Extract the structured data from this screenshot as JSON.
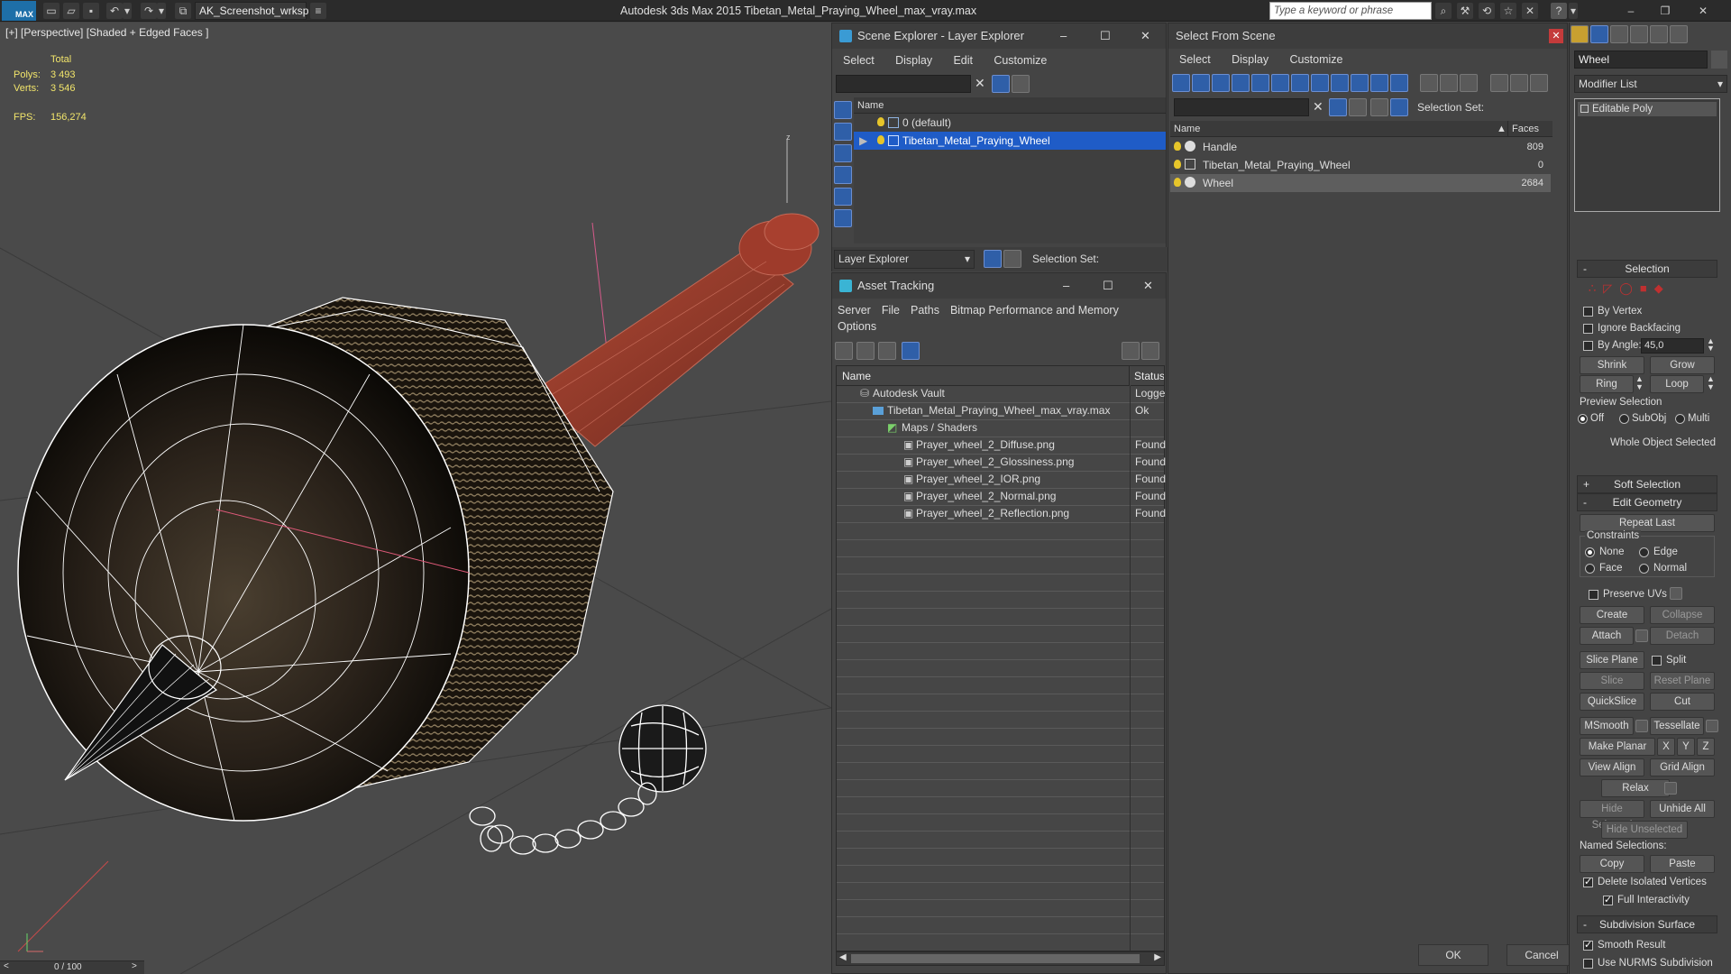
{
  "app": {
    "title": "Autodesk 3ds Max  2015    Tibetan_Metal_Praying_Wheel_max_vray.max",
    "workspace": "AK_Screenshot_wrksp",
    "search_placeholder": "Type a keyword or phrase",
    "logo": "MAX"
  },
  "viewport": {
    "label": "[+] [Perspective] [Shaded + Edged Faces ]",
    "stats_total": "Total",
    "polys_label": "Polys:",
    "polys_value": "3 493",
    "verts_label": "Verts:",
    "verts_value": "3 546",
    "fps_label": "FPS:",
    "fps_value": "156,274",
    "timeline": "0 / 100",
    "axis_label": "z"
  },
  "layer_explorer": {
    "title": "Scene Explorer - Layer Explorer",
    "menu": [
      "Select",
      "Display",
      "Edit",
      "Customize"
    ],
    "col_name": "Name",
    "rows": [
      "0 (default)",
      "Tibetan_Metal_Praying_Wheel"
    ],
    "footer_label": "Layer Explorer",
    "selection_set": "Selection Set:"
  },
  "asset_tracking": {
    "title": "Asset Tracking",
    "menu": [
      "Server",
      "File",
      "Paths",
      "Bitmap Performance and Memory",
      "Options"
    ],
    "col_name": "Name",
    "col_status": "Status",
    "rows": [
      {
        "name": "Autodesk Vault",
        "status": "Logge"
      },
      {
        "name": "Tibetan_Metal_Praying_Wheel_max_vray.max",
        "status": "Ok"
      },
      {
        "name": "Maps / Shaders",
        "status": ""
      },
      {
        "name": "Prayer_wheel_2_Diffuse.png",
        "status": "Found"
      },
      {
        "name": "Prayer_wheel_2_Glossiness.png",
        "status": "Found"
      },
      {
        "name": "Prayer_wheel_2_IOR.png",
        "status": "Found"
      },
      {
        "name": "Prayer_wheel_2_Normal.png",
        "status": "Found"
      },
      {
        "name": "Prayer_wheel_2_Reflection.png",
        "status": "Found"
      }
    ]
  },
  "select_from_scene": {
    "title": "Select From Scene",
    "menu": [
      "Select",
      "Display",
      "Customize"
    ],
    "selection_set": "Selection Set:",
    "col_name": "Name",
    "col_faces": "Faces",
    "rows": [
      {
        "name": "Handle",
        "faces": "809"
      },
      {
        "name": "Tibetan_Metal_Praying_Wheel",
        "faces": "0"
      },
      {
        "name": "Wheel",
        "faces": "2684"
      }
    ],
    "ok": "OK",
    "cancel": "Cancel"
  },
  "command_panel": {
    "object_name": "Wheel",
    "modifier_list": "Modifier List",
    "stack_item": "Editable Poly",
    "selection_title": "Selection",
    "by_vertex": "By Vertex",
    "ignore_backfacing": "Ignore Backfacing",
    "by_angle": "By Angle:",
    "angle_value": "45,0",
    "shrink": "Shrink",
    "grow": "Grow",
    "ring": "Ring",
    "loop": "Loop",
    "preview_selection": "Preview Selection",
    "preview_off": "Off",
    "preview_subobj": "SubObj",
    "preview_multi": "Multi",
    "whole_object": "Whole Object Selected",
    "soft_selection": "Soft Selection",
    "edit_geometry": "Edit Geometry",
    "repeat_last": "Repeat Last",
    "constraints": "Constraints",
    "c_none": "None",
    "c_edge": "Edge",
    "c_face": "Face",
    "c_normal": "Normal",
    "preserve_uvs": "Preserve UVs",
    "create": "Create",
    "collapse": "Collapse",
    "attach": "Attach",
    "detach": "Detach",
    "slice_plane": "Slice Plane",
    "split": "Split",
    "slice": "Slice",
    "reset_plane": "Reset Plane",
    "quickslice": "QuickSlice",
    "cut": "Cut",
    "msmooth": "MSmooth",
    "tessellate": "Tessellate",
    "make_planar": "Make Planar",
    "x": "X",
    "y": "Y",
    "z": "Z",
    "view_align": "View Align",
    "grid_align": "Grid Align",
    "relax": "Relax",
    "hide_selected": "Hide Selected",
    "unhide_all": "Unhide All",
    "hide_unselected": "Hide Unselected",
    "named_selections": "Named Selections:",
    "copy": "Copy",
    "paste": "Paste",
    "delete_isolated": "Delete Isolated Vertices",
    "full_interactivity": "Full Interactivity",
    "subdivision_surface": "Subdivision Surface",
    "smooth_result": "Smooth Result",
    "use_nurms": "Use NURMS Subdivision"
  },
  "colors": {
    "selection": "#1f5cc7",
    "stats": "#f2e56b",
    "wire": "#ffffff",
    "handle": "#8a3a2a"
  }
}
